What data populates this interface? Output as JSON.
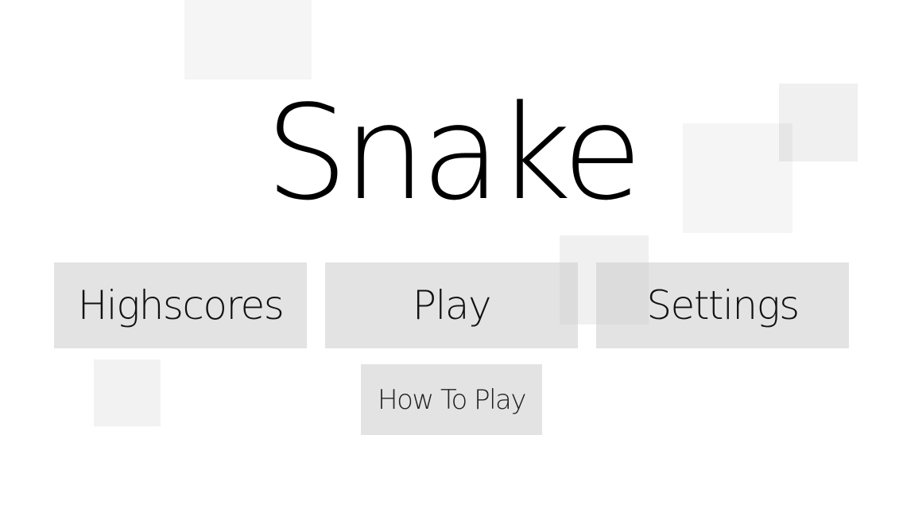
{
  "game": {
    "title": "Snake"
  },
  "menu": {
    "highscores_label": "Highscores",
    "play_label": "Play",
    "settings_label": "Settings",
    "how_to_play_label": "How To Play"
  },
  "colors": {
    "background": "#ffffff",
    "button_fill": "#e5e5e5",
    "text": "#111111"
  }
}
